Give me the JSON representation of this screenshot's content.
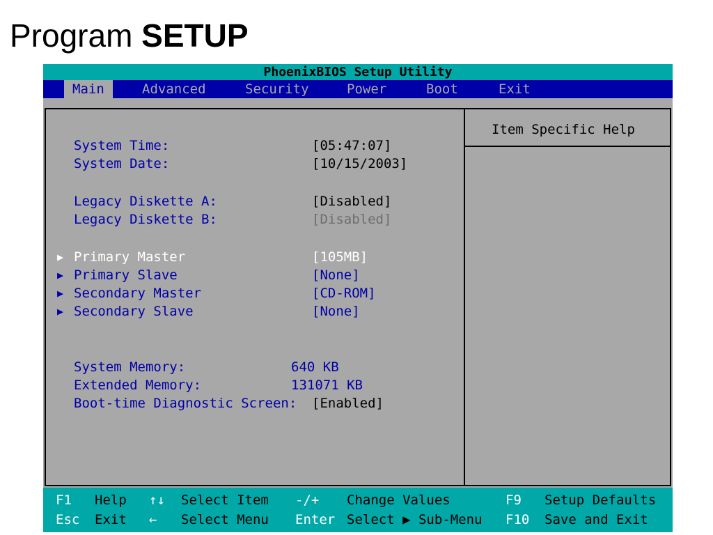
{
  "slide": {
    "title_normal": "Program ",
    "title_bold": "SETUP"
  },
  "bios": {
    "title": "PhoenixBIOS Setup Utility",
    "menu": [
      "Main",
      "Advanced",
      "Security",
      "Power",
      "Boot",
      "Exit"
    ],
    "active_menu": "Main",
    "help_title": "Item Specific Help",
    "items": [
      {
        "label": "System Time:",
        "value": "[05:47:07]"
      },
      {
        "label": "System Date:",
        "value": "[10/15/2003]"
      },
      {
        "label": "Legacy Diskette A:",
        "value": "[Disabled]"
      },
      {
        "label": "Legacy Diskette B:",
        "value": "[Disabled]"
      },
      {
        "label": "Primary Master",
        "value": "[105MB]"
      },
      {
        "label": "Primary Slave",
        "value": "[None]"
      },
      {
        "label": "Secondary Master",
        "value": "[CD-ROM]"
      },
      {
        "label": "Secondary Slave",
        "value": "[None]"
      },
      {
        "label": "System Memory:",
        "value": "640 KB"
      },
      {
        "label": "Extended Memory:",
        "value": "131071 KB"
      },
      {
        "label": "Boot-time Diagnostic Screen:",
        "value": "[Enabled]"
      }
    ],
    "submenu_marker": "▶",
    "footer": {
      "row1": [
        {
          "key": "F1",
          "desc": "Help"
        },
        {
          "key": "↑↓",
          "desc": "Select Item"
        },
        {
          "key": "-/+",
          "desc": "Change Values"
        },
        {
          "key": "F9",
          "desc": "Setup Defaults"
        }
      ],
      "row2": [
        {
          "key": "Esc",
          "desc": "Exit"
        },
        {
          "key": "←",
          "desc": "Select Menu"
        },
        {
          "key": "Enter",
          "desc": "Select ▶ Sub-Menu"
        },
        {
          "key": "F10",
          "desc": "Save and Exit"
        }
      ]
    },
    "colors": {
      "blue": "#0000a8",
      "cyan": "#00a8a8",
      "gray": "#a8a8a8"
    }
  }
}
